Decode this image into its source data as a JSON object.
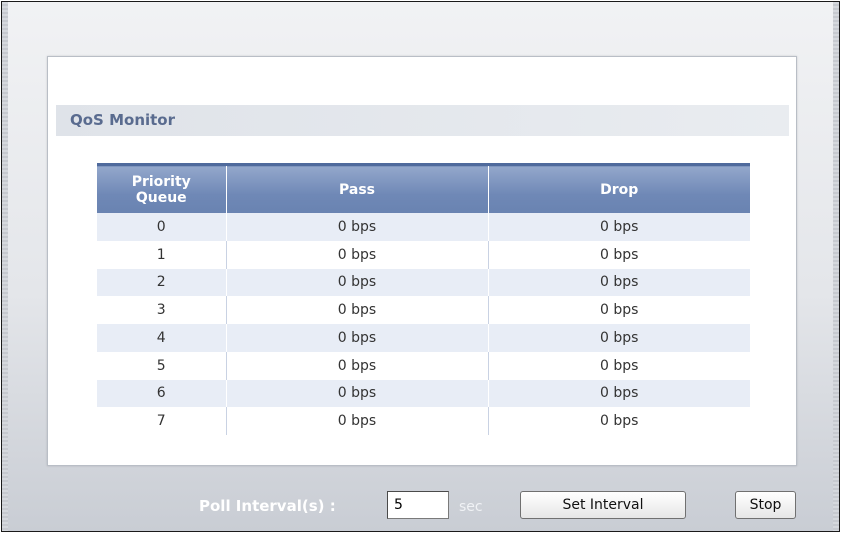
{
  "panel": {
    "title": "QoS Monitor"
  },
  "table": {
    "headers": {
      "queue_line1": "Priority",
      "queue_line2": "Queue",
      "pass": "Pass",
      "drop": "Drop"
    },
    "rows": [
      {
        "queue": "0",
        "pass": "0 bps",
        "drop": "0 bps"
      },
      {
        "queue": "1",
        "pass": "0 bps",
        "drop": "0 bps"
      },
      {
        "queue": "2",
        "pass": "0 bps",
        "drop": "0 bps"
      },
      {
        "queue": "3",
        "pass": "0 bps",
        "drop": "0 bps"
      },
      {
        "queue": "4",
        "pass": "0 bps",
        "drop": "0 bps"
      },
      {
        "queue": "5",
        "pass": "0 bps",
        "drop": "0 bps"
      },
      {
        "queue": "6",
        "pass": "0 bps",
        "drop": "0 bps"
      },
      {
        "queue": "7",
        "pass": "0 bps",
        "drop": "0 bps"
      }
    ]
  },
  "footer": {
    "poll_label": "Poll Interval(s) :",
    "poll_value": "5",
    "sec_label": "sec",
    "set_interval_label": "Set Interval",
    "stop_label": "Stop"
  },
  "colors": {
    "header_blue": "#6f88b6",
    "title_text": "#596b8f",
    "row_alt": "#e8edf6"
  }
}
